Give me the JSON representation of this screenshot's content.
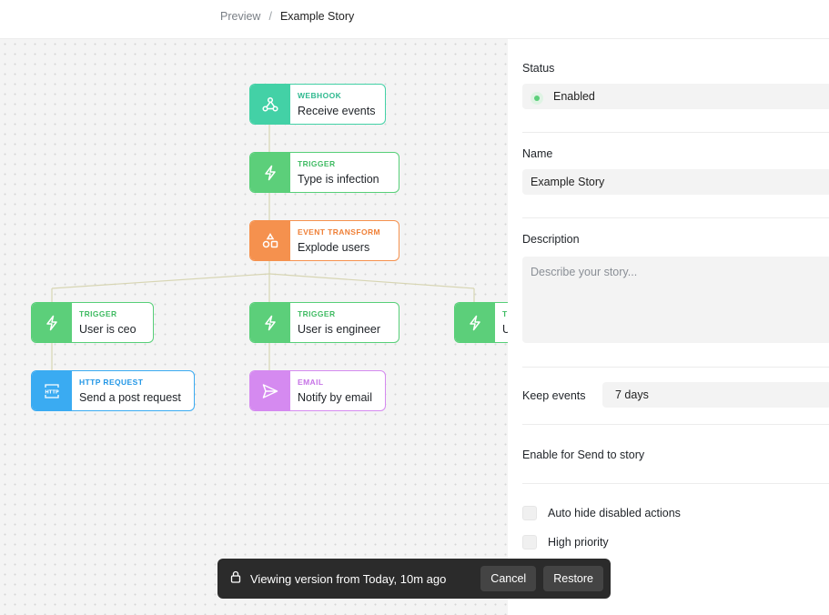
{
  "breadcrumb": {
    "parent": "Preview",
    "separator": "/",
    "current": "Example Story"
  },
  "colors": {
    "webhook": "#43d1a6",
    "trigger": "#5ccf7a",
    "transform": "#f5914e",
    "http": "#3aabf2",
    "email": "#d58af0",
    "edge": "#d7d5b3"
  },
  "nodes": {
    "webhook": {
      "type": "WEBHOOK",
      "label": "Receive events",
      "icon": "webhook-icon"
    },
    "trigger_infection": {
      "type": "TRIGGER",
      "label": "Type is infection",
      "icon": "bolt-icon"
    },
    "transform": {
      "type": "EVENT TRANSFORM",
      "label": "Explode users",
      "icon": "transform-icon"
    },
    "trigger_ceo": {
      "type": "TRIGGER",
      "label": "User is ceo",
      "icon": "bolt-icon"
    },
    "trigger_engineer": {
      "type": "TRIGGER",
      "label": "User is engineer",
      "icon": "bolt-icon"
    },
    "trigger_partial": {
      "type": "T",
      "label": "U",
      "icon": "bolt-icon"
    },
    "http": {
      "type": "HTTP REQUEST",
      "label": "Send a post request",
      "icon": "http-icon",
      "icon_text": "HTTP"
    },
    "email": {
      "type": "EMAIL",
      "label": "Notify by email",
      "icon": "send-icon"
    }
  },
  "version_bar": {
    "icon": "lock-icon",
    "text": "Viewing version from Today, 10m ago",
    "cancel_label": "Cancel",
    "restore_label": "Restore"
  },
  "panel": {
    "status_label": "Status",
    "status_value": "Enabled",
    "name_label": "Name",
    "name_value": "Example Story",
    "description_label": "Description",
    "description_placeholder": "Describe your story...",
    "keep_events_label": "Keep events",
    "keep_events_value": "7 days",
    "send_to_story_label": "Enable for Send to story",
    "options": [
      {
        "label": "Auto hide disabled actions",
        "checked": false
      },
      {
        "label": "High priority",
        "checked": false
      }
    ]
  }
}
